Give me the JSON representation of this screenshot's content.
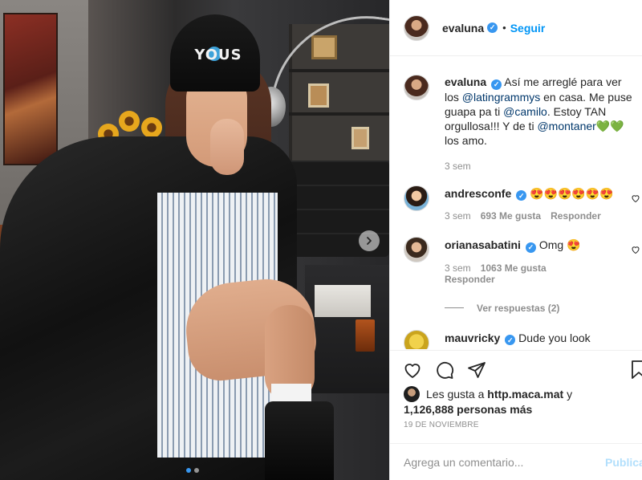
{
  "header": {
    "username": "evaluna",
    "follow_label": "Seguir"
  },
  "caption": {
    "username": "evaluna",
    "text_1": " Así me arreglé para ver los ",
    "mention_1": "@latingrammys",
    "text_2": " en casa. Me puse guapa pa ti ",
    "mention_2": "@camilo",
    "text_3": ". Estoy TAN orgullosa!!! Y de ti ",
    "mention_3": "@montaner",
    "emoji": "💚💚",
    "text_4": "los amo.",
    "time": "3 sem"
  },
  "comments": [
    {
      "username": "andresconfe",
      "text": "😍😍😍😍😍😍",
      "time": "3 sem",
      "likes": "693 Me gusta",
      "reply": "Responder"
    },
    {
      "username": "orianasabatini",
      "text": "Omg 😍",
      "time": "3 sem",
      "likes": "1063 Me gusta",
      "reply": "Responder",
      "view_replies": "Ver respuestas (2)"
    },
    {
      "username": "mauvricky",
      "text": "Dude you look"
    }
  ],
  "likes": {
    "prefix": "Les gusta a ",
    "user": "http.maca.mat",
    "connector": " y",
    "count": "1,126,888 personas más"
  },
  "date": "19 DE NOVIEMBRE",
  "add_comment": {
    "placeholder": "Agrega un comentario...",
    "publish_label": "Publicar"
  },
  "photo": {
    "beanie_text": "YOUS",
    "carousel_total": 2,
    "carousel_active": 1
  },
  "colors": {
    "accent": "#0095f6",
    "verified": "#3897f0",
    "muted": "#8e8e8e",
    "publish_disabled": "#b2dffc"
  }
}
